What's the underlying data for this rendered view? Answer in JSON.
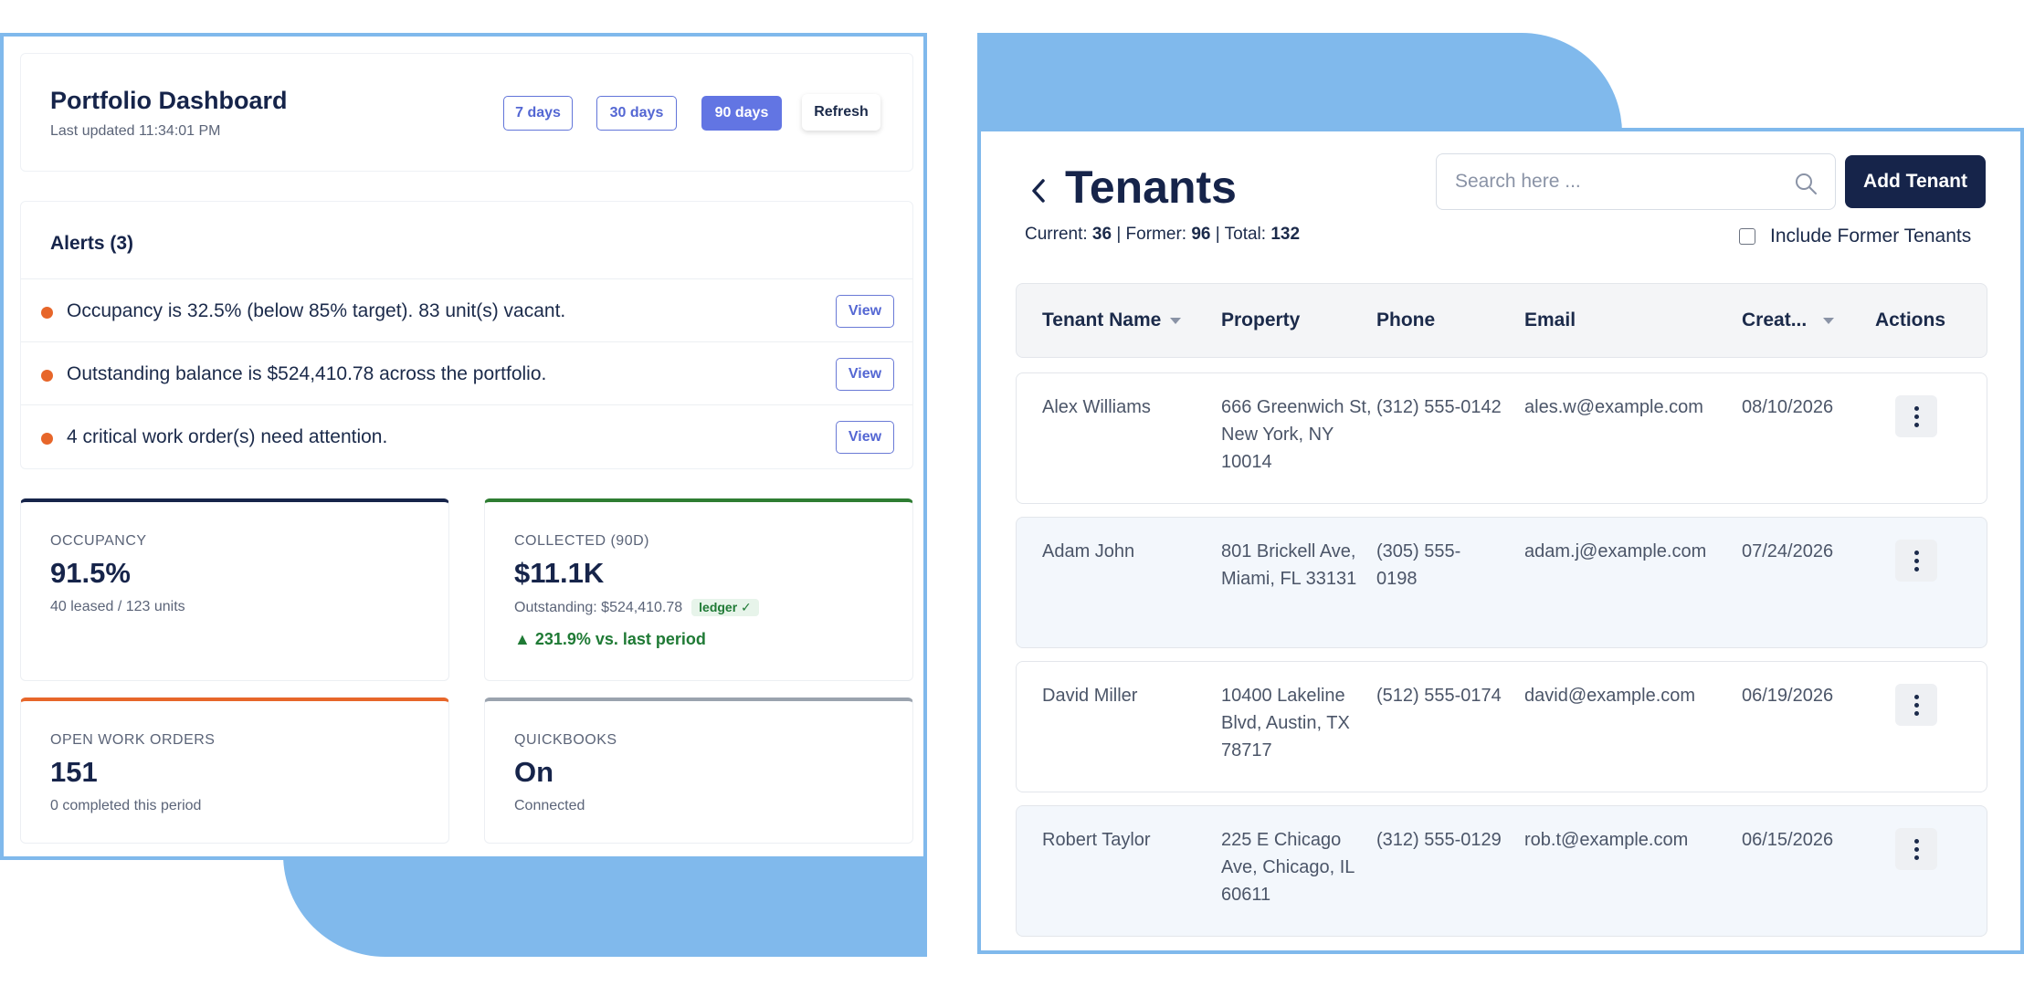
{
  "dashboard": {
    "title": "Portfolio Dashboard",
    "last_updated": "Last updated 11:34:01 PM",
    "ranges": [
      "7 days",
      "30 days",
      "90 days"
    ],
    "active_range": "90 days",
    "refresh_label": "Refresh",
    "alerts": {
      "title": "Alerts (3)",
      "items": [
        {
          "text": "Occupancy is 32.5% (below 85% target). 83 unit(s) vacant.",
          "action": "View"
        },
        {
          "text": "Outstanding balance is $524,410.78 across the portfolio.",
          "action": "View"
        },
        {
          "text": "4 critical work order(s) need attention.",
          "action": "View"
        }
      ]
    },
    "stats": {
      "occupancy": {
        "label": "OCCUPANCY",
        "value": "91.5%",
        "sub": "40 leased / 123 units",
        "color": "#16244a"
      },
      "collected": {
        "label": "COLLECTED (90D)",
        "value": "$11.1K",
        "sub": "Outstanding: $524,410.78",
        "badge": "ledger ✓",
        "trend": "▲ 231.9% vs. last period",
        "color": "#2e7d32"
      },
      "work_orders": {
        "label": "OPEN WORK ORDERS",
        "value": "151",
        "sub": "0 completed this period",
        "color": "#e7662a"
      },
      "quickbooks": {
        "label": "QUICKBOOKS",
        "value": "On",
        "sub": "Connected",
        "color": "#9aa3ae"
      }
    }
  },
  "tenants": {
    "title": "Tenants",
    "counts": {
      "current_label": "Current:",
      "current": "36",
      "former_label": "| Former:",
      "former": "96",
      "total_label": "| Total:",
      "total": "132"
    },
    "search_placeholder": "Search here ...",
    "add_label": "Add Tenant",
    "include_former_label": "Include Former Tenants",
    "columns": [
      "Tenant Name",
      "Property",
      "Phone",
      "Email",
      "Creat...",
      "Actions"
    ],
    "rows": [
      {
        "name": "Alex Williams",
        "property": "666 Greenwich St, New York, NY 10014",
        "phone": "(312) 555-0142",
        "email": "ales.w@example.com",
        "created": "08/10/2026"
      },
      {
        "name": "Adam John",
        "property": "801 Brickell Ave, Miami, FL 33131",
        "phone": "(305) 555-0198",
        "email": "adam.j@example.com",
        "created": "07/24/2026"
      },
      {
        "name": "David Miller",
        "property": "10400 Lakeline Blvd, Austin, TX 78717",
        "phone": "(512) 555-0174",
        "email": "david@example.com",
        "created": "06/19/2026"
      },
      {
        "name": "Robert Taylor",
        "property": "225 E Chicago Ave, Chicago, IL 60611",
        "phone": "(312) 555-0129",
        "email": "rob.t@example.com",
        "created": "06/15/2026"
      }
    ]
  }
}
